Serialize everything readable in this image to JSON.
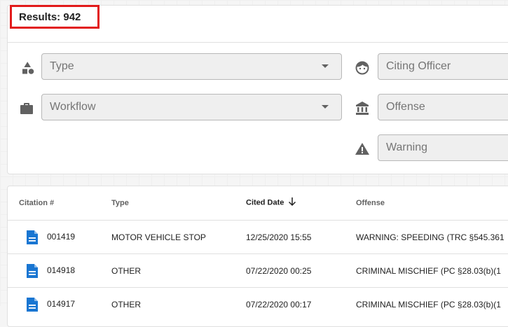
{
  "results": {
    "label": "Results:",
    "count": "942"
  },
  "filters": {
    "type_placeholder": "Type",
    "workflow_placeholder": "Workflow",
    "citing_officer_placeholder": "Citing Officer",
    "offense_placeholder": "Offense",
    "warning_placeholder": "Warning"
  },
  "icons": {
    "type": "shapes-icon",
    "workflow": "briefcase-icon",
    "citing_officer": "face-icon",
    "offense": "courthouse-icon",
    "warning": "warning-icon",
    "row": "document-icon",
    "sort": "arrow-down-icon"
  },
  "colors": {
    "highlight": "#e21b1b",
    "accent": "#1976d2"
  },
  "table": {
    "headers": {
      "citation": "Citation #",
      "type": "Type",
      "cited_date": "Cited Date",
      "offense": "Offense"
    },
    "sort": {
      "column": "Cited Date",
      "direction": "descending"
    },
    "rows": [
      {
        "citation": "001419",
        "type": "MOTOR VEHICLE STOP",
        "cited_date": "12/25/2020 15:55",
        "offense": "WARNING: SPEEDING (TRC §545.361"
      },
      {
        "citation": "014918",
        "type": "OTHER",
        "cited_date": "07/22/2020 00:25",
        "offense": "CRIMINAL MISCHIEF (PC §28.03(b)(1"
      },
      {
        "citation": "014917",
        "type": "OTHER",
        "cited_date": "07/22/2020 00:17",
        "offense": "CRIMINAL MISCHIEF (PC §28.03(b)(1"
      }
    ]
  }
}
